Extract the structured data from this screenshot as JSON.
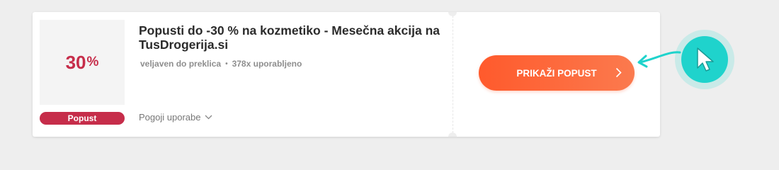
{
  "offer": {
    "discount_number": "30",
    "discount_unit": "%",
    "badge_label": "Popust",
    "title": "Popusti do -30 % na kozmetiko - Mesečna akcija na TusDrogerija.si",
    "validity": "veljaven do preklica",
    "usage": "378x uporabljeno",
    "terms_label": "Pogoji uporabe",
    "cta_label": "PRIKAŽI POPUST"
  },
  "colors": {
    "accent_red": "#c62d4a",
    "cta_orange": "#ff5a2c",
    "cursor_teal": "#1fd3cc"
  },
  "icons": {
    "terms_chevron": "chevron-down-icon",
    "cta_chevron": "chevron-right-icon",
    "pointer": "cursor-icon",
    "hint_arrow": "curved-arrow-icon"
  }
}
